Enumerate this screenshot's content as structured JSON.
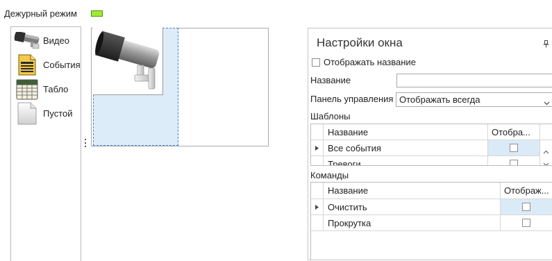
{
  "header": {
    "duty_mode_label": "Дежурный режим"
  },
  "colors": {
    "duty_mode_indicator": "#9eeb34",
    "selection_fill": "#dcecf9",
    "selection_border": "#4d7ec9",
    "current_cell": "#dbeaf7"
  },
  "palette": {
    "items": [
      {
        "label": "Видео",
        "icon": "cctv-camera-icon"
      },
      {
        "label": "События",
        "icon": "events-list-icon"
      },
      {
        "label": "Табло",
        "icon": "board-table-icon"
      },
      {
        "label": "Пустой",
        "icon": "blank-page-icon"
      }
    ]
  },
  "canvas": {
    "tile_icon": "cctv-camera-icon"
  },
  "settings": {
    "title": "Настройки окна",
    "show_name": {
      "label": "Отображать название",
      "checked": false
    },
    "name": {
      "label": "Название",
      "value": ""
    },
    "control_panel": {
      "label": "Панель управления",
      "value": "Отображать всегда"
    },
    "templates": {
      "label": "Шаблоны",
      "columns": [
        "Название",
        "Отобра..."
      ],
      "rows": [
        {
          "name": "Все события",
          "shown": false,
          "current": true
        },
        {
          "name": "Тревоги",
          "shown": false,
          "current": false
        }
      ]
    },
    "commands": {
      "label": "Команды",
      "columns": [
        "Название",
        "Отображ..."
      ],
      "rows": [
        {
          "name": "Очистить",
          "shown": false,
          "current": true
        },
        {
          "name": "Прокрутка",
          "shown": false,
          "current": false
        }
      ]
    }
  }
}
